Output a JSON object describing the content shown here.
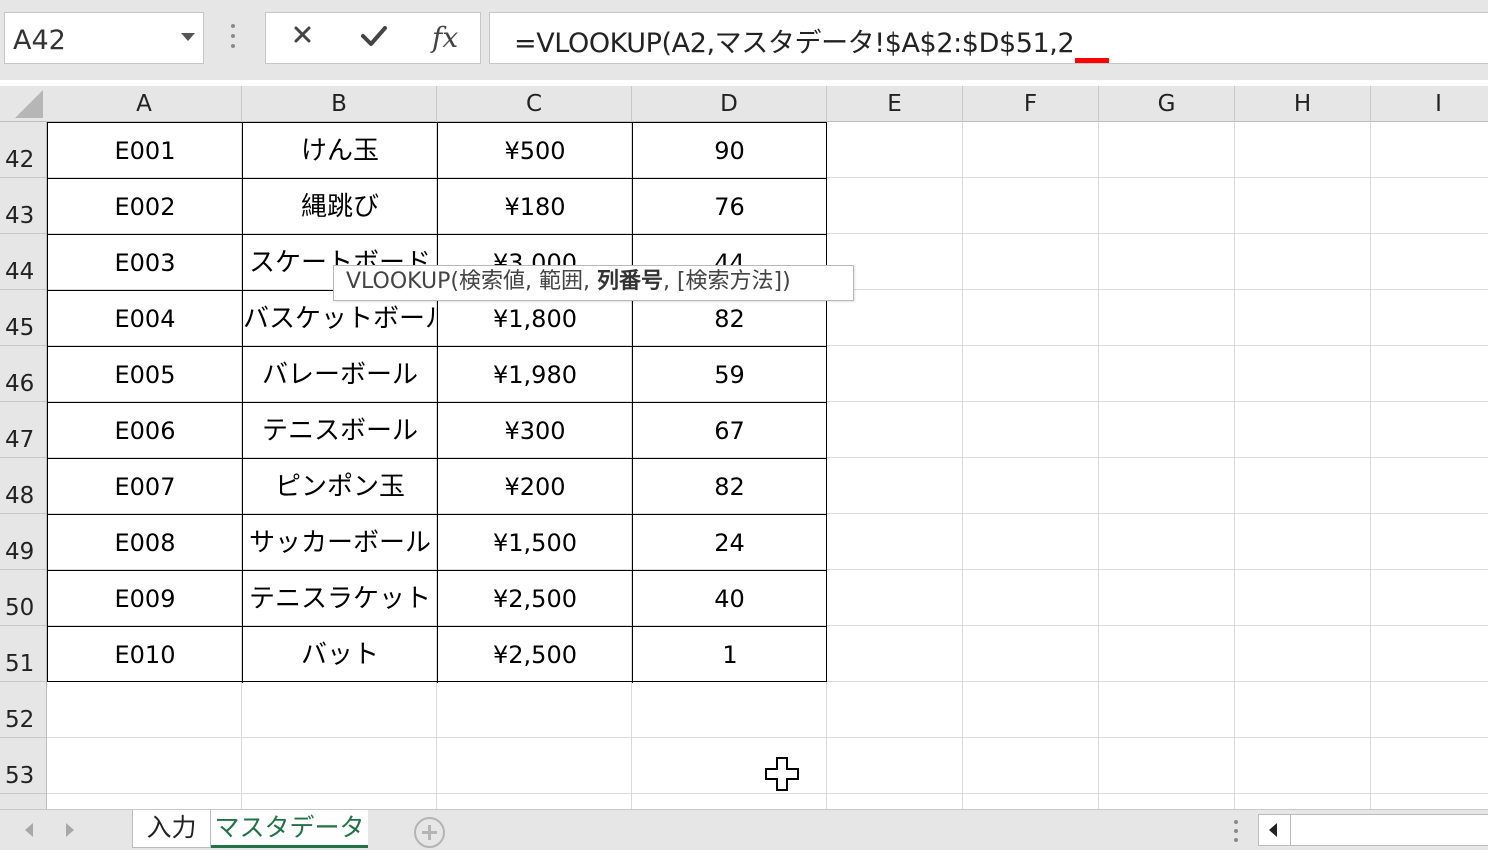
{
  "formula_bar": {
    "name_box": "A42",
    "fx": "fx",
    "formula": "=VLOOKUP(A2,マスタデータ!$A$2:$D$51,2"
  },
  "columns": [
    "A",
    "B",
    "C",
    "D",
    "E",
    "F",
    "G",
    "H",
    "I"
  ],
  "rows": [
    {
      "row": "42",
      "cells": [
        "E001",
        "けん玉",
        "¥500",
        "90"
      ]
    },
    {
      "row": "43",
      "cells": [
        "E002",
        "縄跳び",
        "¥180",
        "76"
      ]
    },
    {
      "row": "44",
      "cells": [
        "E003",
        "スケートボード",
        "¥3,000",
        "44"
      ]
    },
    {
      "row": "45",
      "cells": [
        "E004",
        "バスケットボール",
        "¥1,800",
        "82"
      ]
    },
    {
      "row": "46",
      "cells": [
        "E005",
        "バレーボール",
        "¥1,980",
        "59"
      ]
    },
    {
      "row": "47",
      "cells": [
        "E006",
        "テニスボール",
        "¥300",
        "67"
      ]
    },
    {
      "row": "48",
      "cells": [
        "E007",
        "ピンポン玉",
        "¥200",
        "82"
      ]
    },
    {
      "row": "49",
      "cells": [
        "E008",
        "サッカーボール",
        "¥1,500",
        "24"
      ]
    },
    {
      "row": "50",
      "cells": [
        "E009",
        "テニスラケット",
        "¥2,500",
        "40"
      ]
    },
    {
      "row": "51",
      "cells": [
        "E010",
        "バット",
        "¥2,500",
        "1"
      ]
    },
    {
      "row": "52",
      "cells": []
    },
    {
      "row": "53",
      "cells": []
    }
  ],
  "tooltip": {
    "fn": "VLOOKUP(",
    "arg1": "検索値, 範囲, ",
    "arg_current": "列番号",
    "arg_rest": ", [検索方法])"
  },
  "sheet_tabs": {
    "input": "入力",
    "master": "マスタデータ"
  },
  "colors": {
    "accent": "#217346",
    "formula_marker": "#ff0000"
  }
}
